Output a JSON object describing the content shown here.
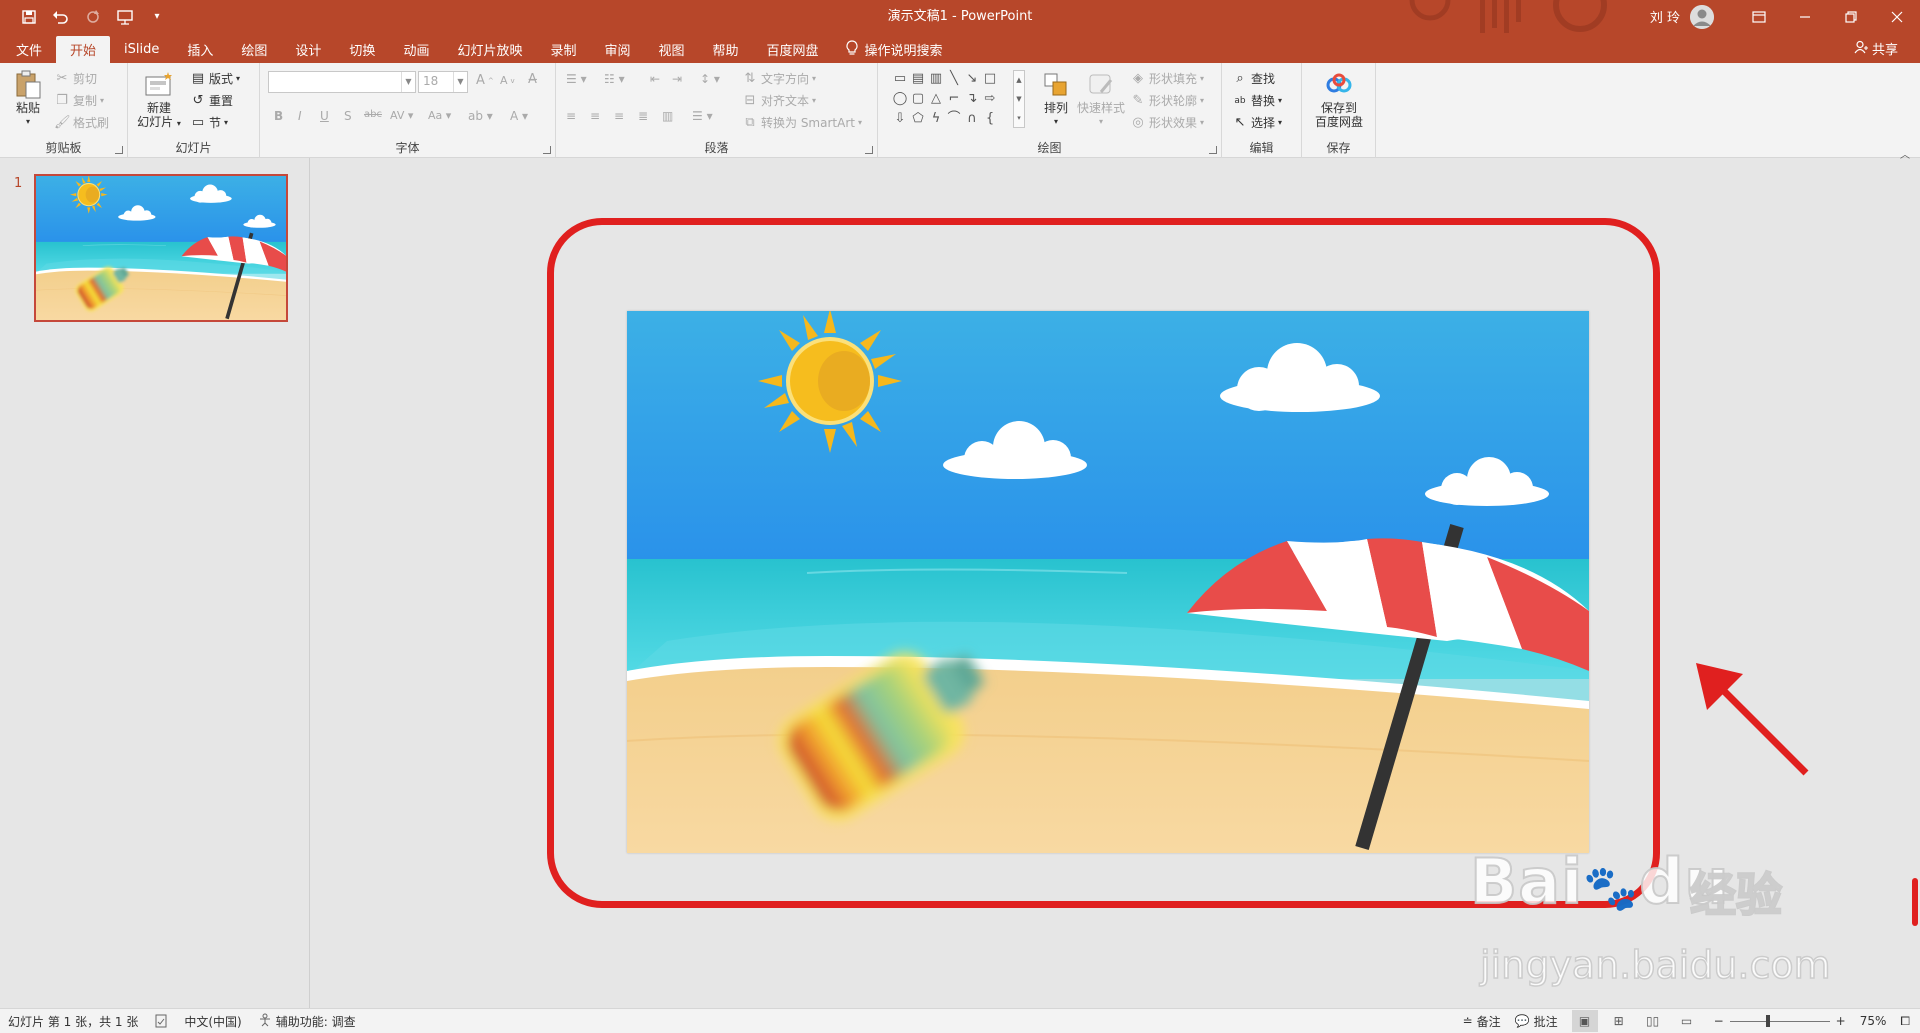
{
  "titlebar": {
    "doc_title": "演示文稿1  -  PowerPoint",
    "user_name": "刘 玲",
    "qat": {
      "save_icon": "save-icon",
      "undo_icon": "undo-icon",
      "redo_icon": "redo-icon",
      "presenter_icon": "start-from-beginning-icon",
      "customize_icon": "customize-qat-icon"
    },
    "window_icons": [
      "ribbon-display-options-icon",
      "minimize-icon",
      "restore-icon",
      "close-icon"
    ]
  },
  "tabs": [
    {
      "label": "文件"
    },
    {
      "label": "开始"
    },
    {
      "label": "iSlide"
    },
    {
      "label": "插入"
    },
    {
      "label": "绘图"
    },
    {
      "label": "设计"
    },
    {
      "label": "切换"
    },
    {
      "label": "动画"
    },
    {
      "label": "幻灯片放映"
    },
    {
      "label": "录制"
    },
    {
      "label": "审阅"
    },
    {
      "label": "视图"
    },
    {
      "label": "帮助"
    },
    {
      "label": "百度网盘"
    }
  ],
  "tell_me": "操作说明搜索",
  "share": "共享",
  "ribbon": {
    "clipboard": {
      "label": "剪贴板",
      "paste": "粘贴",
      "cut": "剪切",
      "copy": "复制",
      "format_painter": "格式刷"
    },
    "slides": {
      "label": "幻灯片",
      "new_slide_line1": "新建",
      "new_slide_line2": "幻灯片",
      "layout": "版式",
      "reset": "重置",
      "section": "节"
    },
    "font": {
      "label": "字体",
      "font_name": "",
      "font_size": "18"
    },
    "paragraph": {
      "label": "段落",
      "text_direction": "文字方向",
      "align_text": "对齐文本",
      "convert_smartart": "转换为 SmartArt"
    },
    "drawing": {
      "label": "绘图",
      "arrange": "排列",
      "quick_styles": "快速样式",
      "shape_fill": "形状填充",
      "shape_outline": "形状轮廓",
      "shape_effects": "形状效果"
    },
    "editing": {
      "label": "编辑",
      "find": "查找",
      "replace": "替换",
      "select": "选择"
    },
    "save": {
      "label": "保存",
      "save_to_line1": "保存到",
      "save_to_line2": "百度网盘"
    }
  },
  "thumbnails": [
    {
      "number": "1"
    }
  ],
  "watermark": {
    "brand": "Bai",
    "brand_tail": "du",
    "cn": "经验",
    "url": "jingyan.baidu.com"
  },
  "statusbar": {
    "slide_info": "幻灯片 第 1 张，共 1 张",
    "language": "中文(中国)",
    "accessibility": "辅助功能: 调查",
    "notes": "备注",
    "comments": "批注",
    "zoom": "75%"
  },
  "colors": {
    "accent": "#b7472a",
    "highlight": "#e0201f"
  }
}
